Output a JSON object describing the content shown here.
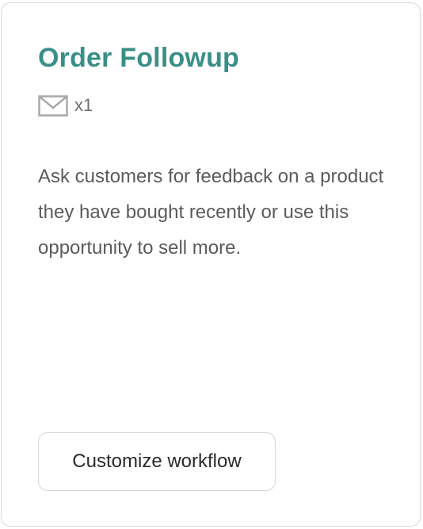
{
  "card": {
    "title": "Order Followup",
    "email_icon": "mail-icon",
    "email_count": "x1",
    "description": "Ask customers for feedback on a product they have bought recently or use this opportunity to sell more.",
    "button_label": "Customize workflow"
  },
  "colors": {
    "title": "#3a8f88",
    "text": "#5b5b5b",
    "border": "#d9d9d9"
  }
}
